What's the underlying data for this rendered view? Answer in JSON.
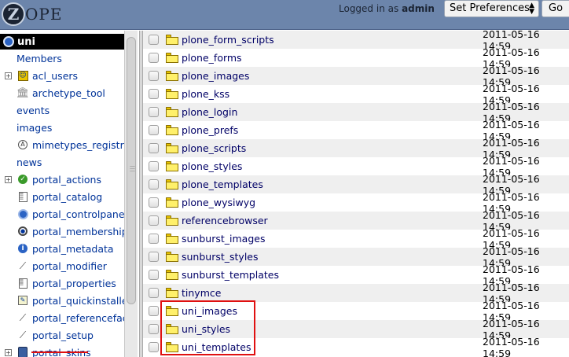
{
  "header": {
    "logo_text": "ZOPE",
    "logo_letter": "Z",
    "logo_rest": "OPE",
    "logged_prefix": "Logged in as",
    "username": "admin",
    "preferences_label": "Set Preferences",
    "go_label": "Go"
  },
  "tree": {
    "root": "uni",
    "items": [
      {
        "label": "Members",
        "icon": "none",
        "expandable": false
      },
      {
        "label": "acl_users",
        "icon": "user-folder-icon",
        "expandable": true
      },
      {
        "label": "archetype_tool",
        "icon": "tool-building-icon",
        "expandable": false
      },
      {
        "label": "events",
        "icon": "none",
        "expandable": false
      },
      {
        "label": "images",
        "icon": "none",
        "expandable": false
      },
      {
        "label": "mimetypes_registry",
        "icon": "mimetypes-icon",
        "expandable": false
      },
      {
        "label": "news",
        "icon": "none",
        "expandable": false
      },
      {
        "label": "portal_actions",
        "icon": "checkmark-icon",
        "expandable": true
      },
      {
        "label": "portal_catalog",
        "icon": "catalog-icon",
        "expandable": false
      },
      {
        "label": "portal_controlpanel",
        "icon": "controlpanel-icon",
        "expandable": false
      },
      {
        "label": "portal_membership",
        "icon": "membership-icon",
        "expandable": false
      },
      {
        "label": "portal_metadata",
        "icon": "info-icon",
        "expandable": false
      },
      {
        "label": "portal_modifier",
        "icon": "wrench-icon",
        "expandable": false
      },
      {
        "label": "portal_properties",
        "icon": "properties-icon",
        "expandable": false
      },
      {
        "label": "portal_quickinstaller",
        "icon": "installer-icon",
        "expandable": false
      },
      {
        "label": "portal_referencefacto",
        "icon": "wrench-icon",
        "expandable": false
      },
      {
        "label": "portal_setup",
        "icon": "wrench-icon",
        "expandable": false
      },
      {
        "label": "portal_skins",
        "icon": "skins-icon",
        "expandable": true
      }
    ]
  },
  "listing": {
    "rows": [
      {
        "name": "plone_form_scripts",
        "date": "2011-05-16 14:59"
      },
      {
        "name": "plone_forms",
        "date": "2011-05-16 14:59"
      },
      {
        "name": "plone_images",
        "date": "2011-05-16 14:59"
      },
      {
        "name": "plone_kss",
        "date": "2011-05-16 14:59"
      },
      {
        "name": "plone_login",
        "date": "2011-05-16 14:59"
      },
      {
        "name": "plone_prefs",
        "date": "2011-05-16 14:59"
      },
      {
        "name": "plone_scripts",
        "date": "2011-05-16 14:59"
      },
      {
        "name": "plone_styles",
        "date": "2011-05-16 14:59"
      },
      {
        "name": "plone_templates",
        "date": "2011-05-16 14:59"
      },
      {
        "name": "plone_wysiwyg",
        "date": "2011-05-16 14:59"
      },
      {
        "name": "referencebrowser",
        "date": "2011-05-16 14:59"
      },
      {
        "name": "sunburst_images",
        "date": "2011-05-16 14:59"
      },
      {
        "name": "sunburst_styles",
        "date": "2011-05-16 14:59"
      },
      {
        "name": "sunburst_templates",
        "date": "2011-05-16 14:59"
      },
      {
        "name": "tinymce",
        "date": "2011-05-16 14:59"
      },
      {
        "name": "uni_images",
        "date": "2011-05-16 14:59"
      },
      {
        "name": "uni_styles",
        "date": "2011-05-16 14:59"
      },
      {
        "name": "uni_templates",
        "date": "2011-05-16 14:59"
      }
    ]
  },
  "colors": {
    "header_bg": "#6c85ab",
    "link": "#003399",
    "highlight": "#e01010",
    "folder": "#fff06a"
  }
}
